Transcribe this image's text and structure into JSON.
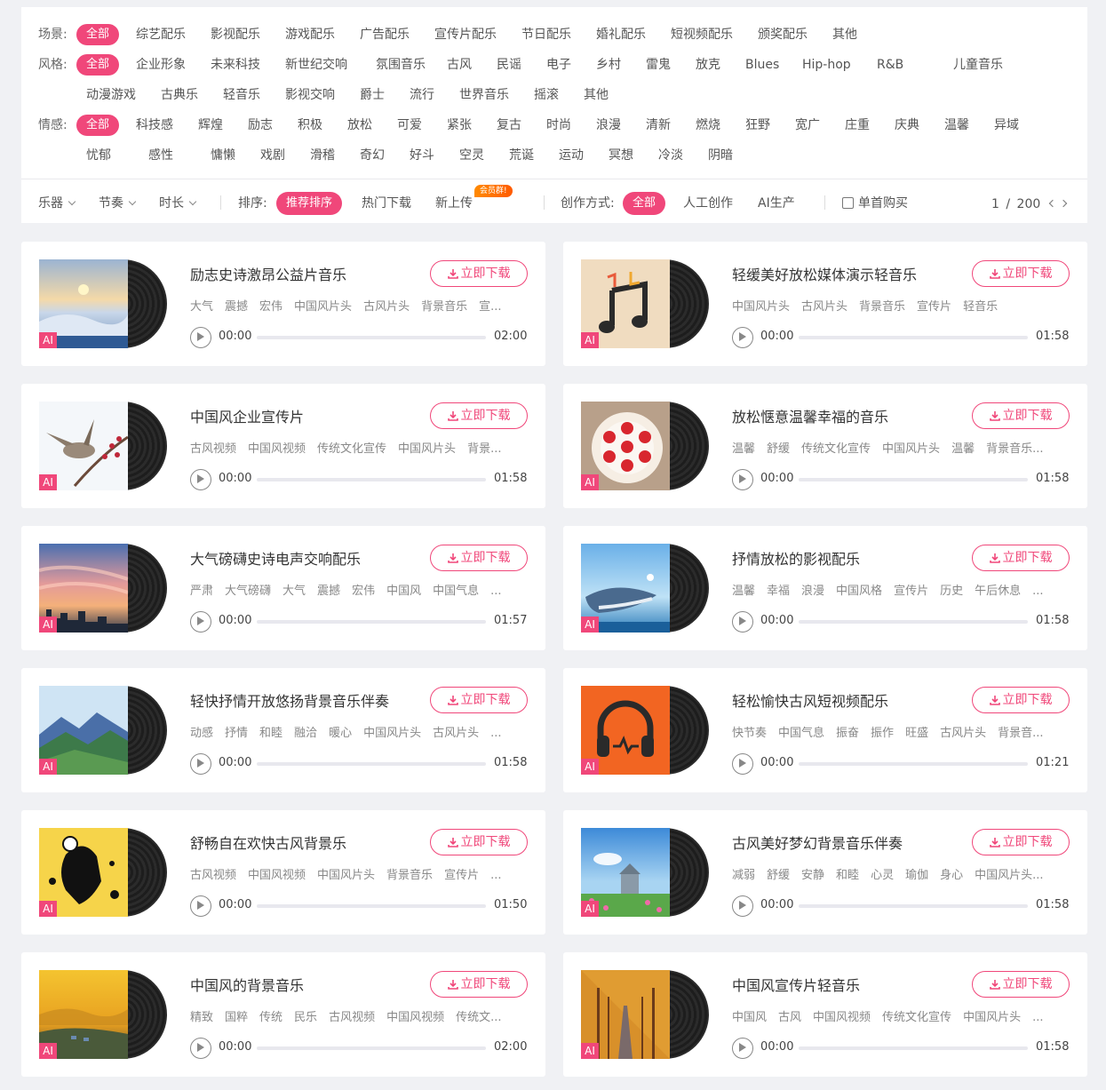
{
  "filters": {
    "scene": {
      "label": "场景:",
      "options": [
        "全部",
        "综艺配乐",
        "影视配乐",
        "游戏配乐",
        "广告配乐",
        "宣传片配乐",
        "节日配乐",
        "婚礼配乐",
        "短视频配乐",
        "颁奖配乐",
        "其他"
      ]
    },
    "style": {
      "label": "风格:",
      "options": [
        "全部",
        "企业形象",
        "未来科技",
        "新世纪交响",
        "氛围音乐",
        "古风",
        "民谣",
        "电子",
        "乡村",
        "雷鬼",
        "放克",
        "Blues",
        "Hip-hop",
        "R&B",
        "儿童音乐",
        "动漫游戏",
        "古典乐",
        "轻音乐",
        "影视交响",
        "爵士",
        "流行",
        "世界音乐",
        "摇滚",
        "其他"
      ]
    },
    "emotion": {
      "label": "情感:",
      "options": [
        "全部",
        "科技感",
        "辉煌",
        "励志",
        "积极",
        "放松",
        "可爱",
        "紧张",
        "复古",
        "时尚",
        "浪漫",
        "清新",
        "燃烧",
        "狂野",
        "宽广",
        "庄重",
        "庆典",
        "温馨",
        "异域",
        "忧郁",
        "感性",
        "慵懒",
        "戏剧",
        "滑稽",
        "奇幻",
        "好斗",
        "空灵",
        "荒诞",
        "运动",
        "冥想",
        "冷淡",
        "阴暗"
      ]
    }
  },
  "toolbar": {
    "instrument": "乐器",
    "rhythm": "节奏",
    "duration": "时长",
    "sort_label": "排序:",
    "sort_options": [
      "推荐排序",
      "热门下载",
      "新上传"
    ],
    "hot_tag": "会员群!",
    "create_label": "创作方式:",
    "create_options": [
      "全部",
      "人工创作",
      "AI生产"
    ],
    "single_buy": "单首购买",
    "page_current": "1",
    "page_sep": "/",
    "page_total": "200"
  },
  "download_label": "立即下载",
  "ai_badge": "AI",
  "tracks": [
    {
      "title": "励志史诗激昂公益片音乐",
      "tags": [
        "大气",
        "震撼",
        "宏伟",
        "中国风片头",
        "古风片头",
        "背景音乐",
        "宣..."
      ],
      "start": "00:00",
      "end": "02:00",
      "cover": "winter-sunrise"
    },
    {
      "title": "轻缓美好放松媒体演示轻音乐",
      "tags": [
        "中国风片头",
        "古风片头",
        "背景音乐",
        "宣传片",
        "轻音乐"
      ],
      "start": "00:00",
      "end": "01:58",
      "cover": "music-notes"
    },
    {
      "title": "中国风企业宣传片",
      "tags": [
        "古风视频",
        "中国风视频",
        "传统文化宣传",
        "中国风片头",
        "背景..."
      ],
      "start": "00:00",
      "end": "01:58",
      "cover": "bird-plum"
    },
    {
      "title": "放松惬意温馨幸福的音乐",
      "tags": [
        "温馨",
        "舒缓",
        "传统文化宣传",
        "中国风片头",
        "温馨",
        "背景音乐..."
      ],
      "start": "00:00",
      "end": "01:58",
      "cover": "strawberry-cake"
    },
    {
      "title": "大气磅礴史诗电声交响配乐",
      "tags": [
        "严肃",
        "大气磅礴",
        "大气",
        "震撼",
        "宏伟",
        "中国风",
        "中国气息",
        "..."
      ],
      "start": "00:00",
      "end": "01:57",
      "cover": "sunset-city"
    },
    {
      "title": "抒情放松的影视配乐",
      "tags": [
        "温馨",
        "幸福",
        "浪漫",
        "中国风格",
        "宣传片",
        "历史",
        "午后休息",
        "..."
      ],
      "start": "00:00",
      "end": "01:58",
      "cover": "whale-sky"
    },
    {
      "title": "轻快抒情开放悠扬背景音乐伴奏",
      "tags": [
        "动感",
        "抒情",
        "和睦",
        "融洽",
        "暖心",
        "中国风片头",
        "古风片头",
        "..."
      ],
      "start": "00:00",
      "end": "01:58",
      "cover": "mountains"
    },
    {
      "title": "轻松愉快古风短视频配乐",
      "tags": [
        "快节奏",
        "中国气息",
        "振奋",
        "振作",
        "旺盛",
        "古风片头",
        "背景音..."
      ],
      "start": "00:00",
      "end": "01:21",
      "cover": "headphones"
    },
    {
      "title": "舒畅自在欢快古风背景乐",
      "tags": [
        "古风视频",
        "中国风视频",
        "中国风片头",
        "背景音乐",
        "宣传片",
        "..."
      ],
      "start": "00:00",
      "end": "01:50",
      "cover": "football-splash"
    },
    {
      "title": "古风美好梦幻背景音乐伴奏",
      "tags": [
        "减弱",
        "舒缓",
        "安静",
        "和睦",
        "心灵",
        "瑜伽",
        "身心",
        "中国风片头..."
      ],
      "start": "00:00",
      "end": "01:58",
      "cover": "flower-field"
    },
    {
      "title": "中国风的背景音乐",
      "tags": [
        "精致",
        "国粹",
        "传统",
        "民乐",
        "古风视频",
        "中国风视频",
        "传统文..."
      ],
      "start": "00:00",
      "end": "02:00",
      "cover": "golden-landscape"
    },
    {
      "title": "中国风宣传片轻音乐",
      "tags": [
        "中国风",
        "古风",
        "中国风视频",
        "传统文化宣传",
        "中国风片头",
        "..."
      ],
      "start": "00:00",
      "end": "01:58",
      "cover": "autumn-road"
    }
  ]
}
